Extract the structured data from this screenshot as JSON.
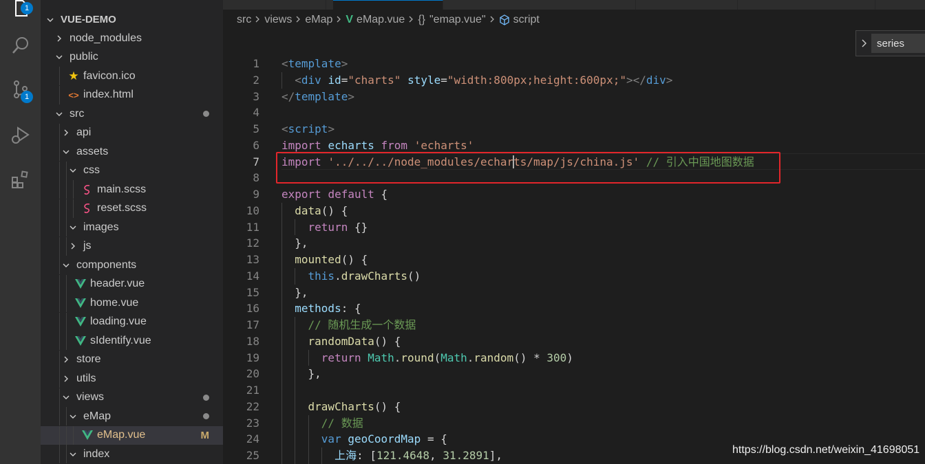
{
  "activity_bar": {
    "explorer_badge": "1",
    "scm_badge": "1",
    "items": [
      "explorer",
      "search",
      "source-control",
      "run-and-debug",
      "extensions"
    ]
  },
  "explorer": {
    "root": "VUE-DEMO",
    "items": [
      {
        "label": "node_modules",
        "kind": "folder",
        "open": false,
        "depth": 1
      },
      {
        "label": "public",
        "kind": "folder",
        "open": true,
        "depth": 1
      },
      {
        "label": "favicon.ico",
        "kind": "star",
        "depth": 2
      },
      {
        "label": "index.html",
        "kind": "html",
        "depth": 2
      },
      {
        "label": "src",
        "kind": "folder",
        "open": true,
        "depth": 1,
        "modified": true
      },
      {
        "label": "api",
        "kind": "folder",
        "open": false,
        "depth": 2
      },
      {
        "label": "assets",
        "kind": "folder",
        "open": true,
        "depth": 2
      },
      {
        "label": "css",
        "kind": "folder",
        "open": true,
        "depth": 3
      },
      {
        "label": "main.scss",
        "kind": "scss",
        "depth": 4
      },
      {
        "label": "reset.scss",
        "kind": "scss",
        "depth": 4
      },
      {
        "label": "images",
        "kind": "folder",
        "open": true,
        "depth": 3
      },
      {
        "label": "js",
        "kind": "folder",
        "open": false,
        "depth": 3
      },
      {
        "label": "components",
        "kind": "folder",
        "open": true,
        "depth": 2
      },
      {
        "label": "header.vue",
        "kind": "vue",
        "depth": 3
      },
      {
        "label": "home.vue",
        "kind": "vue",
        "depth": 3
      },
      {
        "label": "loading.vue",
        "kind": "vue",
        "depth": 3
      },
      {
        "label": "sIdentify.vue",
        "kind": "vue",
        "depth": 3
      },
      {
        "label": "store",
        "kind": "folder",
        "open": false,
        "depth": 2
      },
      {
        "label": "utils",
        "kind": "folder",
        "open": false,
        "depth": 2
      },
      {
        "label": "views",
        "kind": "folder",
        "open": true,
        "depth": 2,
        "modified": true
      },
      {
        "label": "eMap",
        "kind": "folder",
        "open": true,
        "depth": 3,
        "modified": true
      },
      {
        "label": "eMap.vue",
        "kind": "vue",
        "depth": 4,
        "active": true,
        "status": "M"
      },
      {
        "label": "index",
        "kind": "folder",
        "open": true,
        "depth": 3
      }
    ]
  },
  "breadcrumbs": {
    "src": "src",
    "views": "views",
    "emap": "eMap",
    "file": "eMap.vue",
    "object_icon": "{}",
    "object": "\"emap.vue\"",
    "symbol": "script"
  },
  "outline_popup": {
    "label": "series"
  },
  "editor": {
    "lines": [
      {
        "n": "1",
        "tokens": [
          [
            "t-br",
            "<"
          ],
          [
            "t-tag",
            "template"
          ],
          [
            "t-br",
            ">"
          ]
        ]
      },
      {
        "n": "2",
        "tokens": [
          [
            "t-p",
            "  "
          ],
          [
            "t-br",
            "<"
          ],
          [
            "t-tag",
            "div"
          ],
          [
            "t-p",
            " "
          ],
          [
            "t-attr",
            "id"
          ],
          [
            "t-p",
            "="
          ],
          [
            "t-str",
            "\"charts\""
          ],
          [
            "t-p",
            " "
          ],
          [
            "t-attr",
            "style"
          ],
          [
            "t-p",
            "="
          ],
          [
            "t-str",
            "\"width:800px;height:600px;\""
          ],
          [
            "t-br",
            "></"
          ],
          [
            "t-tag",
            "div"
          ],
          [
            "t-br",
            ">"
          ]
        ]
      },
      {
        "n": "3",
        "tokens": [
          [
            "t-br",
            "</"
          ],
          [
            "t-tag",
            "template"
          ],
          [
            "t-br",
            ">"
          ]
        ]
      },
      {
        "n": "4",
        "tokens": []
      },
      {
        "n": "5",
        "tokens": [
          [
            "t-br",
            "<"
          ],
          [
            "t-tag",
            "script"
          ],
          [
            "t-br",
            ">"
          ]
        ]
      },
      {
        "n": "6",
        "tokens": [
          [
            "t-kw",
            "import"
          ],
          [
            "t-p",
            " "
          ],
          [
            "t-var",
            "echarts"
          ],
          [
            "t-p",
            " "
          ],
          [
            "t-kw",
            "from"
          ],
          [
            "t-p",
            " "
          ],
          [
            "t-str",
            "'echarts'"
          ]
        ]
      },
      {
        "n": "7",
        "tokens": [
          [
            "t-kw",
            "import"
          ],
          [
            "t-p",
            " "
          ],
          [
            "t-str",
            "'../../../node_modules/echarts/map/js/china.js'"
          ],
          [
            "t-p",
            " "
          ],
          [
            "t-cm",
            "// 引入中国地图数据"
          ]
        ]
      },
      {
        "n": "8",
        "tokens": []
      },
      {
        "n": "9",
        "tokens": [
          [
            "t-kw",
            "export"
          ],
          [
            "t-p",
            " "
          ],
          [
            "t-kw",
            "default"
          ],
          [
            "t-p",
            " {"
          ]
        ]
      },
      {
        "n": "10",
        "tokens": [
          [
            "t-p",
            "  "
          ],
          [
            "t-fn",
            "data"
          ],
          [
            "t-p",
            "() {"
          ]
        ]
      },
      {
        "n": "11",
        "tokens": [
          [
            "t-p",
            "    "
          ],
          [
            "t-kw",
            "return"
          ],
          [
            "t-p",
            " {}"
          ]
        ]
      },
      {
        "n": "12",
        "tokens": [
          [
            "t-p",
            "  },"
          ]
        ]
      },
      {
        "n": "13",
        "tokens": [
          [
            "t-p",
            "  "
          ],
          [
            "t-fn",
            "mounted"
          ],
          [
            "t-p",
            "() {"
          ]
        ]
      },
      {
        "n": "14",
        "tokens": [
          [
            "t-p",
            "    "
          ],
          [
            "t-blue",
            "this"
          ],
          [
            "t-p",
            "."
          ],
          [
            "t-fn",
            "drawCharts"
          ],
          [
            "t-p",
            "()"
          ]
        ]
      },
      {
        "n": "15",
        "tokens": [
          [
            "t-p",
            "  },"
          ]
        ]
      },
      {
        "n": "16",
        "tokens": [
          [
            "t-p",
            "  "
          ],
          [
            "t-var",
            "methods"
          ],
          [
            "t-p",
            ": {"
          ]
        ]
      },
      {
        "n": "17",
        "tokens": [
          [
            "t-p",
            "    "
          ],
          [
            "t-cm",
            "// 随机生成一个数据"
          ]
        ]
      },
      {
        "n": "18",
        "tokens": [
          [
            "t-p",
            "    "
          ],
          [
            "t-fn",
            "randomData"
          ],
          [
            "t-p",
            "() {"
          ]
        ]
      },
      {
        "n": "19",
        "tokens": [
          [
            "t-p",
            "      "
          ],
          [
            "t-kw",
            "return"
          ],
          [
            "t-p",
            " "
          ],
          [
            "t-cls",
            "Math"
          ],
          [
            "t-p",
            "."
          ],
          [
            "t-fn",
            "round"
          ],
          [
            "t-p",
            "("
          ],
          [
            "t-cls",
            "Math"
          ],
          [
            "t-p",
            "."
          ],
          [
            "t-fn",
            "random"
          ],
          [
            "t-p",
            "() * "
          ],
          [
            "t-num",
            "300"
          ],
          [
            "t-p",
            ")"
          ]
        ]
      },
      {
        "n": "20",
        "tokens": [
          [
            "t-p",
            "    },"
          ]
        ]
      },
      {
        "n": "21",
        "tokens": []
      },
      {
        "n": "22",
        "tokens": [
          [
            "t-p",
            "    "
          ],
          [
            "t-fn",
            "drawCharts"
          ],
          [
            "t-p",
            "() {"
          ]
        ]
      },
      {
        "n": "23",
        "tokens": [
          [
            "t-p",
            "      "
          ],
          [
            "t-cm",
            "// 数据"
          ]
        ]
      },
      {
        "n": "24",
        "tokens": [
          [
            "t-p",
            "      "
          ],
          [
            "t-blue",
            "var"
          ],
          [
            "t-p",
            " "
          ],
          [
            "t-var",
            "geoCoordMap"
          ],
          [
            "t-p",
            " = {"
          ]
        ]
      },
      {
        "n": "25",
        "tokens": [
          [
            "t-p",
            "        "
          ],
          [
            "t-var",
            "上海"
          ],
          [
            "t-p",
            ": ["
          ],
          [
            "t-num",
            "121.4648"
          ],
          [
            "t-p",
            ", "
          ],
          [
            "t-num",
            "31.2891"
          ],
          [
            "t-p",
            "],"
          ]
        ]
      }
    ],
    "current_line": "7"
  },
  "watermark": "https://blog.csdn.net/weixin_41698051"
}
